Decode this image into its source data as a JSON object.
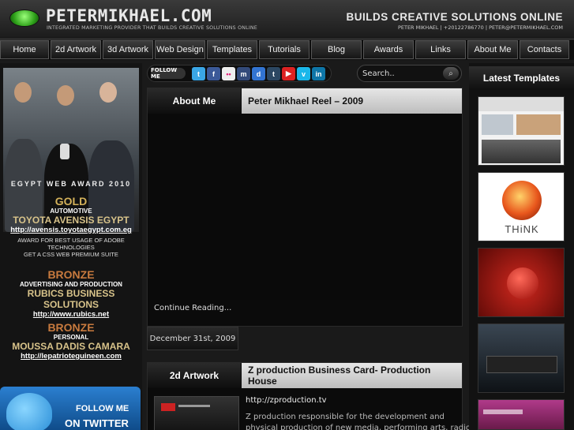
{
  "header": {
    "logo": "PETERMIKHAEL.COM",
    "tagline": "INTEGRATED MARKETING PROVIDER THAT BUILDS CREATIVE SOLUTIONS ONLINE",
    "right_title": "BUILDS CREATIVE SOLUTIONS ONLINE",
    "right_contact": "PETER MIKHAEL | +20122786770 | PETER@PETERMIKHAEL.COM"
  },
  "nav": [
    "Home",
    "2d Artwork",
    "3d Artwork",
    "Web Design",
    "Templates",
    "Tutorials",
    "Blog",
    "Awards",
    "Links",
    "About Me",
    "Contacts"
  ],
  "awards": {
    "title": "EGYPT WEB AWARD 2010",
    "items": [
      {
        "medal": "GOLD",
        "category": "AUTOMOTIVE",
        "name": "TOYOTA AVENSIS EGYPT",
        "link": "http://avensis.toyotaegypt.com.eg",
        "note1": "AWARD FOR BEST USAGE OF ADOBE TECHNOLOGIES",
        "note2": "GET A CSS WEB PREMIUM SUITE"
      },
      {
        "medal": "BRONZE",
        "category": "ADVERTISING AND PRODUCTION",
        "name": "RUBICS BUSINESS SOLUTIONS",
        "link": "http://www.rubics.net"
      },
      {
        "medal": "BRONZE",
        "category": "PERSONAL",
        "name": "MOUSSA DADIS CAMARA",
        "link": "http://lepatrioteguineen.com"
      }
    ]
  },
  "twitter": {
    "line1": "FOLLOW ME",
    "line2": "ON TWITTER"
  },
  "follow": {
    "label": "FOLLOW ME",
    "icons": [
      {
        "name": "twitter-icon",
        "glyph": "t",
        "color": "#3aa6e6"
      },
      {
        "name": "facebook-icon",
        "glyph": "f",
        "color": "#3b5998"
      },
      {
        "name": "flickr-icon",
        "glyph": "••",
        "color": "#ddd"
      },
      {
        "name": "myspace-icon",
        "glyph": "m",
        "color": "#334a7a"
      },
      {
        "name": "delicious-icon",
        "glyph": "d",
        "color": "#3274d2"
      },
      {
        "name": "tumblr-icon",
        "glyph": "t",
        "color": "#2c4762"
      },
      {
        "name": "youtube-icon",
        "glyph": "▶",
        "color": "#d22"
      },
      {
        "name": "vimeo-icon",
        "glyph": "v",
        "color": "#1ab7ea"
      },
      {
        "name": "linkedin-icon",
        "glyph": "in",
        "color": "#0e76a8"
      }
    ]
  },
  "search": {
    "placeholder": "Search.."
  },
  "posts": [
    {
      "category": "About Me",
      "title": "Peter Mikhael Reel – 2009",
      "continue": "Continue Reading...",
      "date": "December 31st, 2009"
    },
    {
      "category": "2d Artwork",
      "title": "Z production Business Card- Production House",
      "url": "http://zproduction.tv",
      "excerpt1": "Z production responsible for the development and",
      "excerpt2": "physical production of new media, performing arts, radio,"
    }
  ],
  "right": {
    "heading": "Latest Templates"
  }
}
